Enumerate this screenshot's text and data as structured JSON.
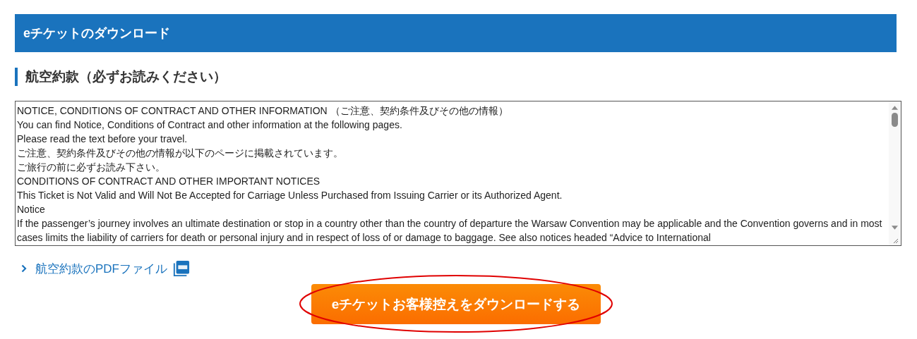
{
  "header": {
    "title": "eチケットのダウンロード"
  },
  "section": {
    "title": "航空約款（必ずお読みください）"
  },
  "conditions_box": {
    "lines": [
      "NOTICE, CONDITIONS OF CONTRACT AND OTHER INFORMATION （ご注意、契約条件及びその他の情報）",
      "You can find Notice, Conditions of Contract and other information at the following pages.",
      "Please read the text before your travel.",
      "ご注意、契約条件及びその他の情報が以下のページに掲載されています。",
      "ご旅行の前に必ずお読み下さい。",
      "CONDITIONS OF CONTRACT AND OTHER IMPORTANT NOTICES",
      "This Ticket is Not Valid and Will Not Be Accepted for Carriage Unless Purchased from Issuing Carrier or its Authorized Agent.",
      "Notice",
      "If the passenger’s journey involves an ultimate destination or stop in a country other than the country of departure the Warsaw Convention may be applicable and the Convention governs and in most cases limits the liability of carriers for death or personal injury and in respect of loss of or damage to baggage. See also notices headed “Advice to International"
    ]
  },
  "pdf_link": {
    "label": "航空約款のPDFファイル"
  },
  "download_button": {
    "label": "eチケットお客様控えをダウンロードする",
    "circled": true
  }
}
